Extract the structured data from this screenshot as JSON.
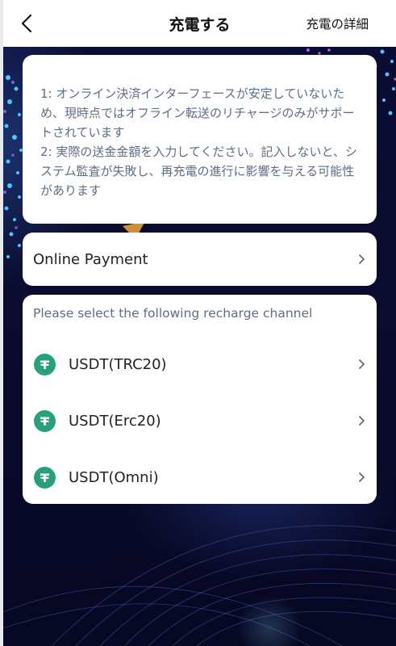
{
  "header": {
    "title": "充電する",
    "detail_link": "充電の詳細",
    "back_icon": "chevron-left-icon"
  },
  "notice": {
    "line1": "1: オンライン決済インターフェースが安定していないため、現時点ではオフライン転送のリチャージのみがサポートされています",
    "line2": "2: 実際の送金金額を入力してください。記入しないと、システム監査が失敗し、再充電の進行に影響を与える可能性があります"
  },
  "online_payment": {
    "label": "Online Payment"
  },
  "channels": {
    "heading": "Please select the following recharge channel",
    "items": [
      {
        "label": "USDT(TRC20)",
        "icon": "tether-icon"
      },
      {
        "label": "USDT(Erc20)",
        "icon": "tether-icon"
      },
      {
        "label": "USDT(Omni)",
        "icon": "tether-icon"
      }
    ]
  },
  "colors": {
    "background": "#0a0b2e",
    "card": "#ffffff",
    "muted_text": "#5e6d86",
    "tether_green": "#26a17b"
  }
}
